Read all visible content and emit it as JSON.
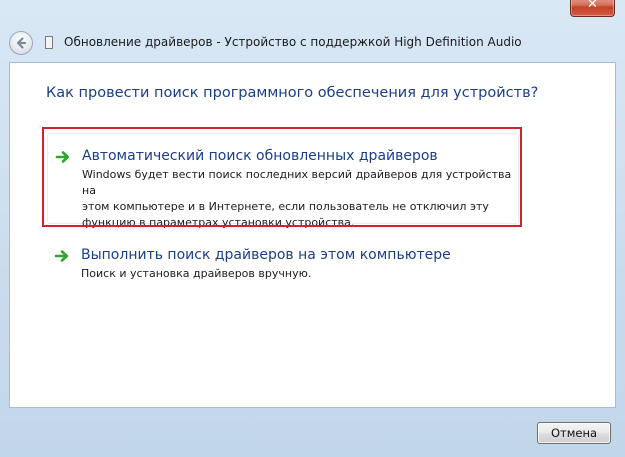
{
  "window": {
    "title": "Обновление драйверов - Устройство с поддержкой High Definition Audio",
    "close_label": "✕"
  },
  "content": {
    "question": "Как провести поиск программного обеспечения для устройств?",
    "options": [
      {
        "title": "Автоматический поиск обновленных драйверов",
        "description": "Windows будет вести поиск последних версий драйверов для устройства на\nэтом компьютере и в Интернете, если пользователь не отключил эту\nфункцию в параметрах установки устройства."
      },
      {
        "title": "Выполнить поиск драйверов на этом компьютере",
        "description": "Поиск и установка драйверов вручную."
      }
    ]
  },
  "footer": {
    "cancel_label": "Отмена"
  },
  "colors": {
    "link_blue": "#1a3e8a",
    "arrow_green": "#2fa52f",
    "highlight_red": "#d2222d"
  },
  "icons": {
    "back": "back-arrow-icon",
    "device": "document-icon",
    "option": "green-arrow-icon"
  }
}
